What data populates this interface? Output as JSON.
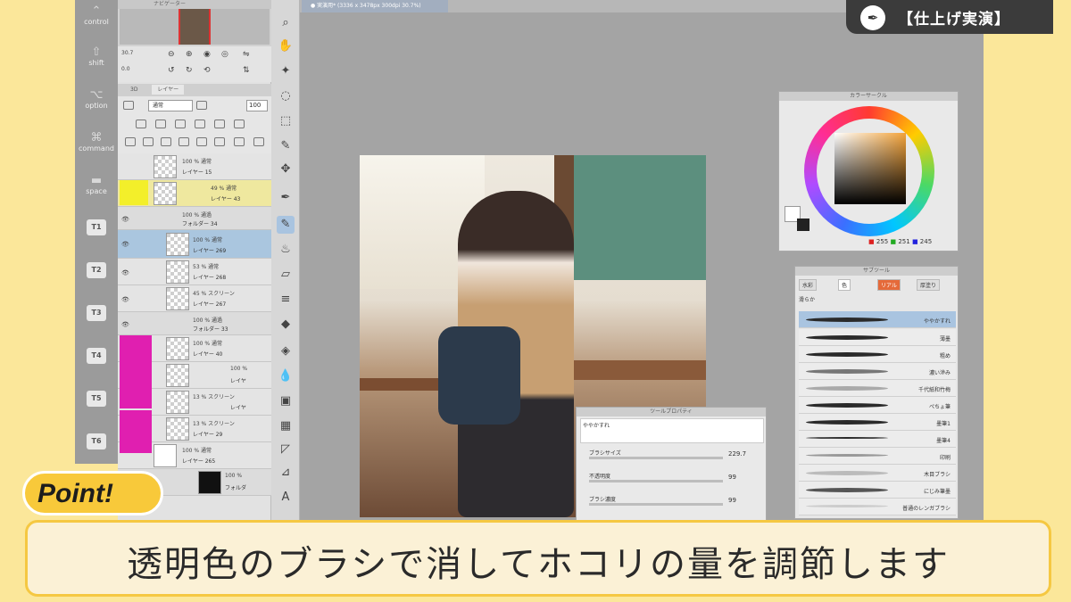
{
  "badge": {
    "title": "【仕上げ実演】"
  },
  "shortcuts": {
    "items": [
      {
        "label": "control",
        "glyph": "⌃"
      },
      {
        "label": "shift",
        "glyph": "⇧"
      },
      {
        "label": "option",
        "glyph": "⌥"
      },
      {
        "label": "command",
        "glyph": "⌘"
      },
      {
        "label": "space",
        "glyph": "▬"
      }
    ],
    "keys": [
      "T1",
      "T2",
      "T3",
      "T4",
      "T5",
      "T6"
    ]
  },
  "navigator": {
    "title": "ナビゲーター",
    "zoom": "30.7",
    "angle": "0.0"
  },
  "layer_panel": {
    "tabs": [
      "3D",
      "レイヤー"
    ],
    "blend_mode": "通常",
    "opacity": "100",
    "layers": [
      {
        "opacity": "100 % 通常",
        "name": "レイヤー 15"
      },
      {
        "opacity": "49 % 通常",
        "name": "レイヤー 43"
      },
      {
        "opacity": "100 % 通過",
        "name": "フォルダー 34"
      },
      {
        "opacity": "100 % 通常",
        "name": "レイヤー 269"
      },
      {
        "opacity": "53 % 通常",
        "name": "レイヤー 268"
      },
      {
        "opacity": "45 % スクリーン",
        "name": "レイヤー 267"
      },
      {
        "opacity": "100 % 通過",
        "name": "フォルダー 33"
      },
      {
        "opacity": "100 % 通常",
        "name": "レイヤー 40"
      },
      {
        "opacity": "100 %",
        "name": "レイヤ"
      },
      {
        "opacity": "13 % スクリーン",
        "name": "レイヤ"
      },
      {
        "opacity": "13 % スクリーン",
        "name": "レイヤー 29"
      },
      {
        "opacity": "100 % 通常",
        "name": "レイヤー 265"
      },
      {
        "opacity": "100 %",
        "name": "フォルダ"
      }
    ]
  },
  "canvas": {
    "tab_label": "● 実演用* (3336 x 3478px 300dpi 30.7%)"
  },
  "color_panel": {
    "title": "カラーサークル",
    "r": "255",
    "g": "251",
    "b": "245"
  },
  "subtool": {
    "title": "サブツール",
    "tabs": [
      "水彩",
      "色",
      "リアル",
      "厚塗り"
    ],
    "sub_label": "滑らか",
    "brushes": [
      "ややかすれ",
      "薄墨",
      "粗め",
      "濃い滲み",
      "千代紙和竹梅",
      "ぺちょ筆",
      "墨筆1",
      "墨筆4",
      "印刷",
      "木目ブラシ",
      "にじみ筆墨",
      "普通のレンガブラシ"
    ]
  },
  "tool_property": {
    "title": "ツールプロパティ",
    "preset": "ややかすれ",
    "rows": [
      {
        "label": "ブラシサイズ",
        "value": "229.7"
      },
      {
        "label": "不透明度",
        "value": "99"
      },
      {
        "label": "ブラシ濃度",
        "value": "99"
      }
    ]
  },
  "point_label": "Point!",
  "caption": "透明色のブラシで消してホコリの量を調節します",
  "colors": {
    "accent": "#f5c842",
    "background": "#fbe79a",
    "magenta": "#e01fb0",
    "yellow_key": "#f3ef2a"
  }
}
